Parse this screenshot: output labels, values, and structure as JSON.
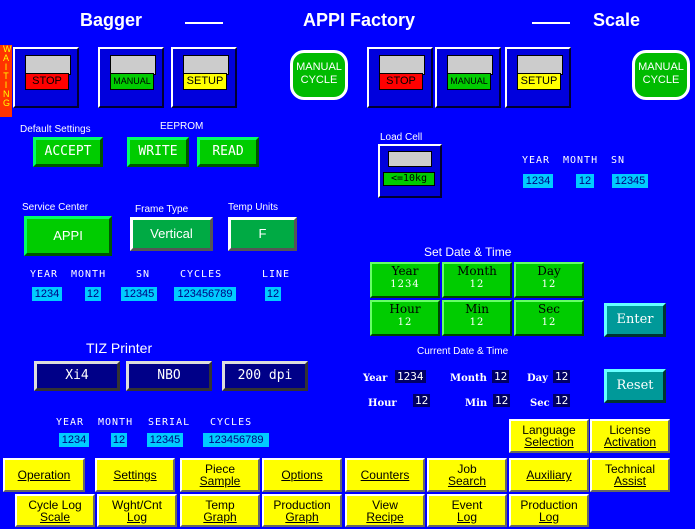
{
  "header": {
    "left_title": "Bagger",
    "center_title": "APPI Factory",
    "right_title": "Scale",
    "status": "WAITING"
  },
  "bagger_controls": {
    "stop": "STOP",
    "manual": "MANUAL",
    "setup": "SETUP",
    "manual_cycle": "MANUAL CYCLE"
  },
  "scale_controls": {
    "stop": "STOP",
    "manual": "MANUAL",
    "setup": "SETUP",
    "manual_cycle": "MANUAL CYCLE"
  },
  "default_settings": {
    "label": "Default Settings",
    "accept": "ACCEPT"
  },
  "eeprom": {
    "label": "EEPROM",
    "write": "WRITE",
    "read": "READ"
  },
  "load_cell": {
    "label": "Load Cell",
    "value": "<=10kg"
  },
  "scale_info": {
    "year_label": "YEAR",
    "month_label": "MONTH",
    "sn_label": "SN",
    "year": "1234",
    "month": "12",
    "sn": "12345"
  },
  "service_center": {
    "label": "Service Center",
    "value": "APPI"
  },
  "frame_type": {
    "label": "Frame Type",
    "value": "Vertical"
  },
  "temp_units": {
    "label": "Temp Units",
    "value": "F"
  },
  "bagger_info": {
    "year_label": "YEAR",
    "month_label": "MONTH",
    "sn_label": "SN",
    "cycles_label": "CYCLES",
    "line_label": "LINE",
    "year": "1234",
    "month": "12",
    "sn": "12345",
    "cycles": "123456789",
    "line": "12"
  },
  "set_date_time": {
    "label": "Set Date & Time",
    "year_label": "Year",
    "year": "1234",
    "month_label": "Month",
    "month": "12",
    "day_label": "Day",
    "day": "12",
    "hour_label": "Hour",
    "hour": "12",
    "min_label": "Min",
    "min": "12",
    "sec_label": "Sec",
    "sec": "12",
    "enter": "Enter",
    "reset": "Reset"
  },
  "current_date_time": {
    "label": "Current Date & Time",
    "year_label": "Year",
    "year": "1234",
    "month_label": "Month",
    "month": "12",
    "day_label": "Day",
    "day": "12",
    "hour_label": "Hour",
    "hour": "12",
    "min_label": "Min",
    "min": "12",
    "sec_label": "Sec",
    "sec": "12"
  },
  "tiz_printer": {
    "label": "TIZ Printer",
    "model": "Xi4",
    "mode": "NBO",
    "resolution": "200 dpi",
    "year_label": "YEAR",
    "month_label": "MONTH",
    "serial_label": "SERIAL",
    "cycles_label": "CYCLES",
    "year": "1234",
    "month": "12",
    "serial": "12345",
    "cycles": "123456789"
  },
  "top_right_nav": {
    "language_1": "Language",
    "language_2": "Selection",
    "license_1": "License",
    "license_2": "Activation"
  },
  "nav_row1": {
    "operation": "Operation",
    "settings": "Settings",
    "piece_sample_1": "Piece",
    "piece_sample_2": "Sample",
    "options": "Options",
    "counters": "Counters",
    "job_search_1": "Job",
    "job_search_2": "Search",
    "auxiliary": "Auxiliary",
    "technical_assist_1": "Technical",
    "technical_assist_2": "Assist"
  },
  "nav_row2": {
    "cycle_log_1": "Cycle Log",
    "cycle_log_2": "Scale",
    "wght_cnt_1": "Wght/Cnt",
    "wght_cnt_2": "Log",
    "temp_graph_1": "Temp",
    "temp_graph_2": "Graph",
    "production_graph_1": "Production",
    "production_graph_2": "Graph",
    "view_recipe_1": "View",
    "view_recipe_2": "Recipe",
    "event_log_1": "Event",
    "event_log_2": "Log",
    "production_log_1": "Production",
    "production_log_2": "Log"
  }
}
